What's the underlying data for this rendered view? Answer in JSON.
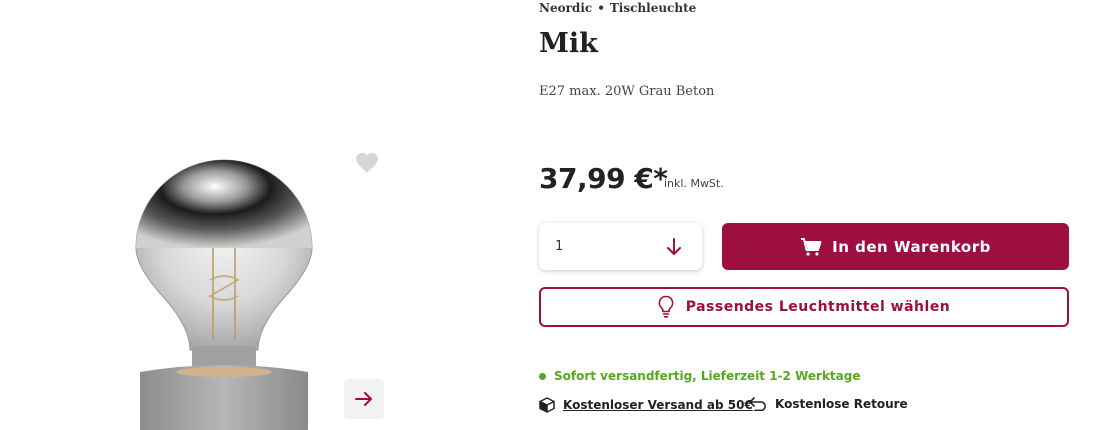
{
  "product": {
    "brand": "Neordic",
    "category": "Tischleuchte",
    "title": "Mik",
    "subtitle": "E27 max. 20W Grau Beton"
  },
  "price": {
    "value": "37,99 €*",
    "tax_note": "inkl. MwSt."
  },
  "purchase": {
    "quantity": "1",
    "cart_label": "In den Warenkorb",
    "match_label": "Passendes Leuchtmittel wählen"
  },
  "availability": {
    "stock_text": "Sofort versandfertig, Lieferzeit 1-2 Werktage",
    "shipping_text": "Kostenloser Versand ab 50€",
    "return_text": "Kostenlose Retoure"
  },
  "icons": {
    "wishlist": "heart-icon",
    "next": "arrow-right-icon",
    "quantity": "arrow-down-icon",
    "cart": "cart-icon",
    "bulb": "lightbulb-icon",
    "shipping": "box-icon",
    "return": "return-arrow-icon"
  },
  "colors": {
    "accent": "#9c0f40",
    "stock": "#55a81f",
    "heart": "#d6d6d6"
  }
}
